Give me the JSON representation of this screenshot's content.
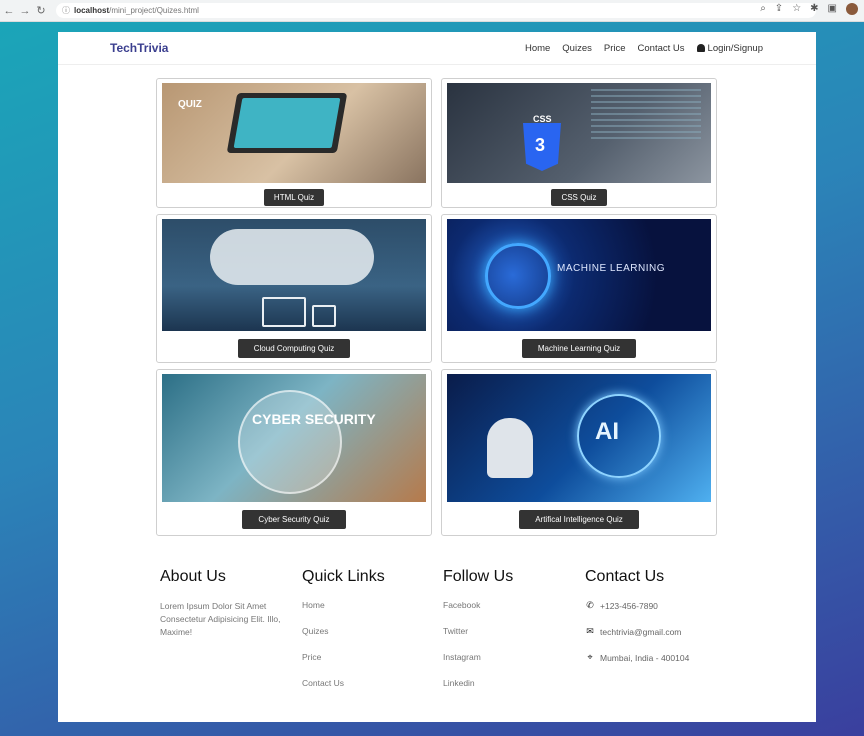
{
  "browser": {
    "url_host": "localhost",
    "url_path": "/mini_project/Quizes.html"
  },
  "header": {
    "brand": "TechTrivia",
    "nav": [
      "Home",
      "Quizes",
      "Price",
      "Contact Us"
    ],
    "login": "Login/Signup"
  },
  "quizzes": [
    {
      "label": "HTML Quiz",
      "image_text": "QUIZ"
    },
    {
      "label": "CSS Quiz",
      "image_text": "CSS"
    },
    {
      "label": "Cloud Computing Quiz"
    },
    {
      "label": "Machine Learning Quiz",
      "image_text": "MACHINE LEARNING"
    },
    {
      "label": "Cyber Security Quiz",
      "image_text": "CYBER SECURITY"
    },
    {
      "label": "Artifical Intelligence Quiz",
      "image_text": "AI"
    }
  ],
  "footer": {
    "about": {
      "title": "About Us",
      "text": "Lorem Ipsum Dolor Sit Amet Consectetur Adipisicing Elit. Illo, Maxime!"
    },
    "quick_links": {
      "title": "Quick Links",
      "items": [
        "Home",
        "Quizes",
        "Price",
        "Contact Us"
      ]
    },
    "follow": {
      "title": "Follow Us",
      "items": [
        "Facebook",
        "Twitter",
        "Instagram",
        "Linkedin"
      ]
    },
    "contact": {
      "title": "Contact Us",
      "phone": "+123-456-7890",
      "email": "techtrivia@gmail.com",
      "address": "Mumbai, India - 400104"
    }
  }
}
